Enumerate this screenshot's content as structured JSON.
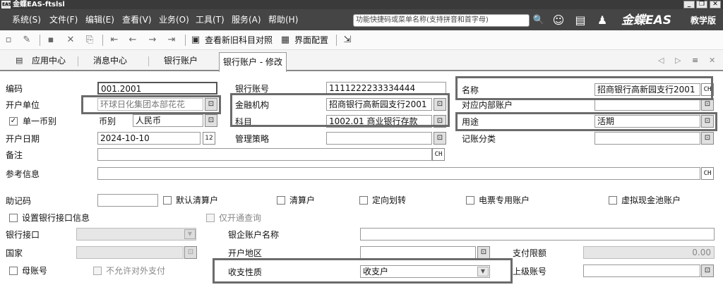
{
  "window": {
    "title": "金蝶EAS-ftslsl",
    "app_icon": "EAS",
    "controls": [
      "_",
      "❐",
      "✕"
    ]
  },
  "menu": {
    "items": [
      "系统(S)",
      "文件(F)",
      "编辑(E)",
      "查看(V)",
      "业务(O)",
      "工具(T)",
      "服务(A)",
      "帮助(H)"
    ],
    "search_placeholder": "功能快捷码或菜单名称(支持拼音和首字母)",
    "brand": "金蝶EAS",
    "edition": "教学版"
  },
  "toolbar": {
    "view_new_old_label": "查看新旧科目对照",
    "interface_config_label": "界面配置"
  },
  "tabs": [
    "应用中心",
    "消息中心",
    "银行账户",
    "银行账户 - 修改"
  ],
  "form": {
    "code_label": "编码",
    "code_value": "001.2001",
    "bank_account_no_label": "银行账号",
    "bank_account_no_value": "1111222233334444",
    "name_label": "名称",
    "name_value": "招商银行高新园支行2001",
    "opening_unit_label": "开户单位",
    "opening_unit_value": "环球日化集团本部花花",
    "financial_institution_label": "金融机构",
    "financial_institution_value": "招商银行高新园支行2001",
    "internal_account_label": "对应内部账户",
    "internal_account_value": "",
    "single_currency_label": "单一币别",
    "single_currency_checked": true,
    "currency_label": "币别",
    "currency_value": "人民币",
    "subject_label": "科目",
    "subject_value": "1002.01  商业银行存款",
    "purpose_label": "用途",
    "purpose_value": "活期",
    "open_date_label": "开户日期",
    "open_date_value": "2024-10-10",
    "management_strategy_label": "管理策略",
    "management_strategy_value": "",
    "account_category_label": "记账分类",
    "account_category_value": "",
    "remark_label": "备注",
    "remark_value": "",
    "ref_info_label": "参考信息",
    "ref_info_value": "",
    "mnemonic_label": "助记码",
    "mnemonic_value": "",
    "default_clearing_label": "默认清算户",
    "clearing_label": "清算户",
    "directed_transfer_label": "定向划转",
    "e_ticket_label": "电票专用账户",
    "virtual_pool_label": "虚拟现金池账户",
    "set_bank_interface_label": "设置银行接口信息",
    "query_only_label": "仅开通查询",
    "bank_interface_label": "银行接口",
    "bank_interface_value": "",
    "bank_enterprise_name_label": "银企账户名称",
    "bank_enterprise_name_value": "",
    "country_label": "国家",
    "country_value": "",
    "opening_region_label": "开户地区",
    "opening_region_value": "",
    "payment_limit_label": "支付限额",
    "payment_limit_value": "0.00",
    "parent_account_flag_label": "母账号",
    "no_external_payment_label": "不允许对外支付",
    "income_expense_label": "收支性质",
    "income_expense_value": "收支户",
    "parent_account_no_label": "上级账号",
    "parent_account_no_value": "",
    "ch_label": "CH"
  }
}
